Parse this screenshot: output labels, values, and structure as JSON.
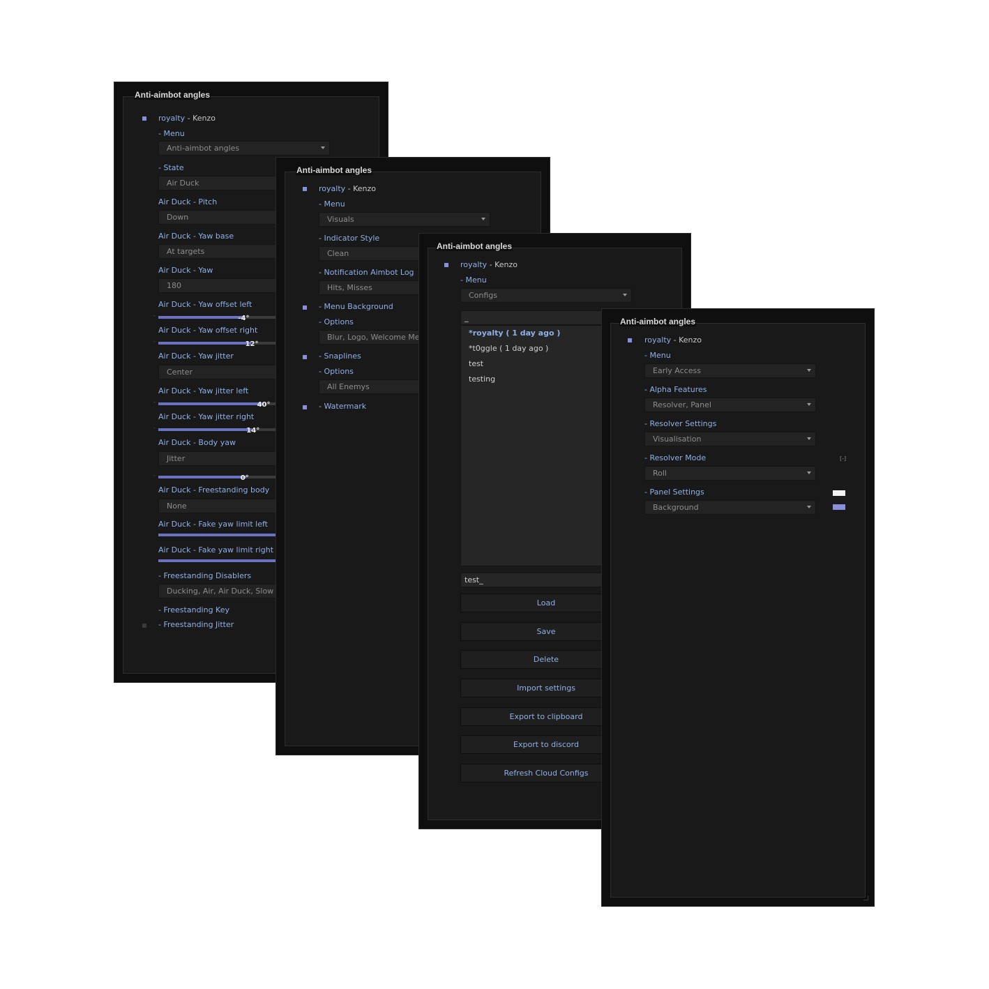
{
  "accent": "#8fb0e8",
  "p1": {
    "title": "Anti-aimbot angles",
    "user_name": "royalty",
    "user_suffix": " - Kenzo",
    "menu_label": "- Menu",
    "menu_value": "Anti-aimbot angles",
    "state_label": "- State",
    "state_value": "Air Duck",
    "pitch_label": "Air Duck - Pitch",
    "pitch_value": "Down",
    "yawbase_label": "Air Duck - Yaw base",
    "yawbase_value": "At targets",
    "yaw_label": "Air Duck - Yaw",
    "yaw_value": "180",
    "yawoffl_label": "Air Duck - Yaw offset left",
    "yawoffl_value": "-4°",
    "yawoffl_fraction": 0.72,
    "yawoffr_label": "Air Duck - Yaw offset right",
    "yawoffr_value": "12°",
    "yawoffr_fraction": 0.78,
    "jitter_label": "Air Duck - Yaw jitter",
    "jitter_value": "Center",
    "jitterl_label": "Air Duck - Yaw jitter left",
    "jitterl_value": "40°",
    "jitterl_fraction": 0.88,
    "jitterr_label": "Air Duck - Yaw jitter right",
    "jitterr_value": "14°",
    "jitterr_fraction": 0.79,
    "bodyyaw_label": "Air Duck - Body yaw",
    "bodyyaw_value": "Jitter",
    "bodyyaw_slider_value": "0°",
    "bodyyaw_fraction": 0.74,
    "freebody_label": "Air Duck - Freestanding body",
    "freebody_value": "None",
    "fakel_label": "Air Duck - Fake yaw limit left",
    "faker_label": "Air Duck - Fake yaw limit right",
    "disablers_label": "- Freestanding Disablers",
    "disablers_value": "Ducking, Air, Air Duck, Slow",
    "fskey_label": "- Freestanding Key",
    "fsjitter_label": "- Freestanding Jitter"
  },
  "p2": {
    "title": "Anti-aimbot angles",
    "user_name": "royalty",
    "user_suffix": " - Kenzo",
    "menu_label": "- Menu",
    "menu_value": "Visuals",
    "indicator_label": "- Indicator Style",
    "indicator_value": "Clean",
    "notif_label": "- Notification Aimbot Log",
    "notif_value": "Hits, Misses",
    "menubg_label": "- Menu Background",
    "options1_label": "- Options",
    "options1_value": "Blur, Logo, Welcome Message",
    "snaplines_label": "- Snaplines",
    "options2_label": "- Options",
    "options2_value": "All Enemys",
    "watermark_label": "- Watermark"
  },
  "p3": {
    "title": "Anti-aimbot angles",
    "user_name": "royalty",
    "user_suffix": " - Kenzo",
    "menu_label": "- Menu",
    "menu_value": "Configs",
    "search_value": "_",
    "configs": [
      "*royalty ( 1 day ago )",
      "*t0ggle ( 1 day ago )",
      "test",
      "testing"
    ],
    "name_value": "test_",
    "buttons": {
      "load": "Load",
      "save": "Save",
      "delete": "Delete",
      "import": "Import settings",
      "export_clip": "Export to clipboard",
      "export_discord": "Export to discord",
      "refresh": "Refresh Cloud Configs"
    }
  },
  "p4": {
    "title": "Anti-aimbot angles",
    "user_name": "royalty",
    "user_suffix": " - Kenzo",
    "menu_label": "- Menu",
    "menu_value": "Early Access",
    "alpha_label": "- Alpha Features",
    "alpha_value": "Resolver, Panel",
    "resolver_label": "- Resolver Settings",
    "resolver_value": "Visualisation",
    "mode_label": "- Resolver Mode",
    "mode_key": "[-]",
    "mode_value": "Roll",
    "panelset_label": "- Panel Settings",
    "panelset_value": "Background",
    "swatch1": "#f2f2f2",
    "swatch2": "#8a8fdc"
  }
}
